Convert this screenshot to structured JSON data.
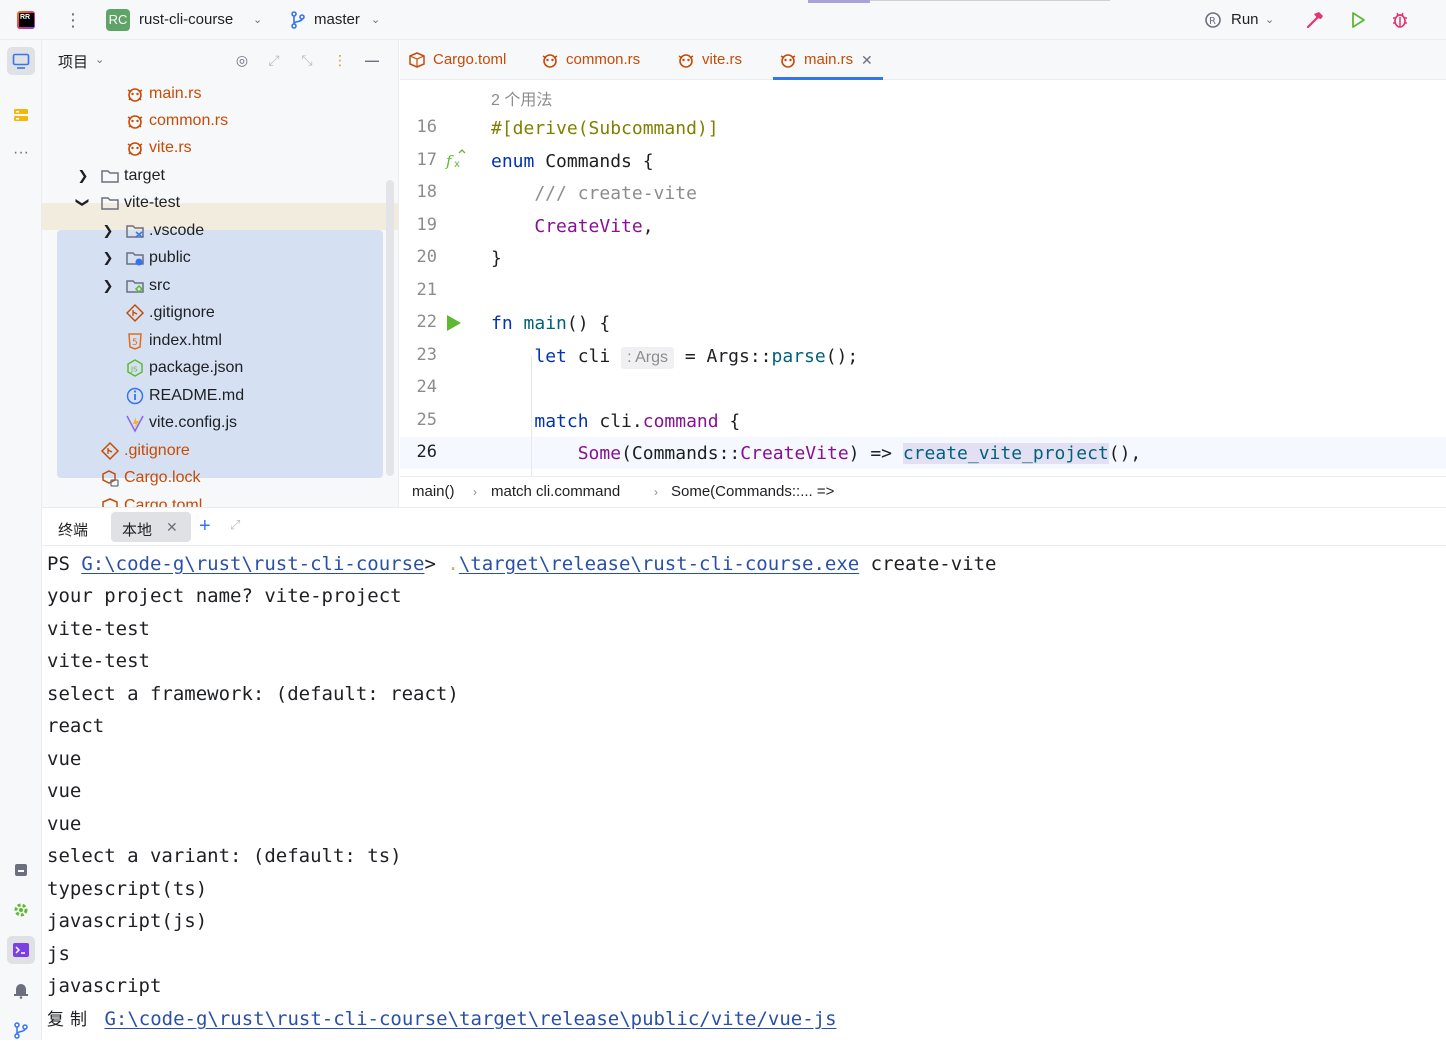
{
  "titlebar": {
    "project_badge": "RC",
    "project_name": "rust-cli-course",
    "branch": "master",
    "run_label": "Run"
  },
  "project_panel": {
    "title": "项目",
    "tree": [
      {
        "label": "main.rs",
        "kind": "rust"
      },
      {
        "label": "common.rs",
        "kind": "rust"
      },
      {
        "label": "vite.rs",
        "kind": "rust"
      },
      {
        "label": "target",
        "kind": "folder"
      },
      {
        "label": "vite-test",
        "kind": "folder"
      },
      {
        "label": ".vscode",
        "kind": "folder-vscode"
      },
      {
        "label": "public",
        "kind": "folder-web"
      },
      {
        "label": "src",
        "kind": "folder-src"
      },
      {
        "label": ".gitignore",
        "kind": "git"
      },
      {
        "label": "index.html",
        "kind": "html"
      },
      {
        "label": "package.json",
        "kind": "json"
      },
      {
        "label": "README.md",
        "kind": "info"
      },
      {
        "label": "vite.config.js",
        "kind": "vite"
      },
      {
        "label": ".gitignore",
        "kind": "git"
      },
      {
        "label": "Cargo.lock",
        "kind": "cargo-lock"
      },
      {
        "label": "Cargo.toml",
        "kind": "cargo"
      }
    ]
  },
  "editor": {
    "tabs": [
      {
        "label": "Cargo.toml"
      },
      {
        "label": "common.rs"
      },
      {
        "label": "vite.rs"
      },
      {
        "label": "main.rs",
        "active": true
      }
    ],
    "usages_hint": "2 个用法",
    "line_numbers": [
      "16",
      "17",
      "18",
      "19",
      "20",
      "21",
      "22",
      "23",
      "24",
      "25",
      "26"
    ],
    "code": {
      "l16": "#[derive(Subcommand)]",
      "l17_kw": "enum",
      "l17_name": " Commands {",
      "l18": "    /// create-vite",
      "l19_variant": "CreateVite",
      "l19_end": ",",
      "l20": "}",
      "l22_kw": "fn",
      "l22_name": "main",
      "l22_end": "() {",
      "l23_kw": "let",
      "l23_var": " cli",
      "l23_hint": ": Args",
      "l23_rest": " = Args::",
      "l23_call": "parse",
      "l23_end": "();",
      "l25_kw": "match",
      "l25_obj": " cli.",
      "l25_field": "command",
      "l25_end": " {",
      "l26_some": "Some",
      "l26_mid": "(Commands::",
      "l26_variant": "CreateVite",
      "l26_arrow": ") => ",
      "l26_call": "create_vite_project",
      "l26_end": "(),"
    },
    "breadcrumbs": [
      "main()",
      "match cli.command",
      "Some(Commands::... =>"
    ]
  },
  "terminal": {
    "title": "终端",
    "tab_label": "本地",
    "lines": {
      "ps_prefix": "PS ",
      "ps_path": "G:\\code-g\\rust\\rust-cli-course",
      "ps_gt": "> ",
      "ps_dot": ".",
      "ps_exe": "\\target\\release\\rust-cli-course.exe",
      "ps_arg": " create-vite",
      "l2": "your project name? vite-project",
      "l3": "vite-test",
      "l4": "vite-test",
      "l5": "select a framework: (default: react)",
      "l6": "react",
      "l7": "vue",
      "l8": "vue",
      "l9": "vue",
      "l10": "select a variant: (default: ts)",
      "l11": "typescript(ts)",
      "l12": "javascript(js)",
      "l13": "js",
      "l14": "javascript",
      "copy_label": "复制",
      "copy_path": "G:\\code-g\\rust\\rust-cli-course\\target\\release\\public/vite/vue-js"
    }
  },
  "colors": {
    "accent": "#3574f0",
    "selection": "#d5e1f2",
    "rust_file": "#c64b06",
    "keyword": "#0033b3",
    "run_green": "#5fb832"
  }
}
